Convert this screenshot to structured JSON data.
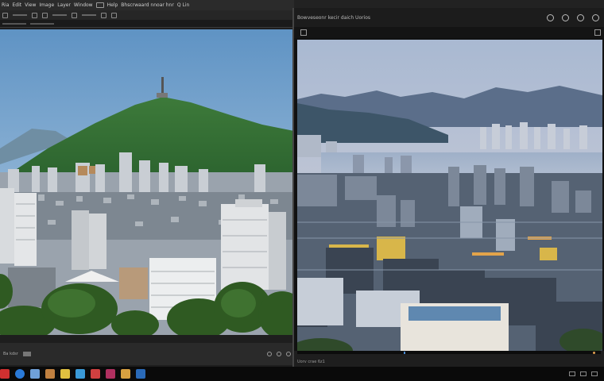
{
  "left_window": {
    "menu_label": "Ria",
    "menu_items": [
      "Edit",
      "View",
      "Image",
      "Layer",
      "Window"
    ],
    "toolbar_labels": [
      "Help",
      "Bhscrwaard nnoar hnr",
      "Q Lin"
    ],
    "status_text": "Ba  kdsr"
  },
  "right_window": {
    "title": "Bowveseonr kecir daich Uorios",
    "status_text": "Uorv crae 6z1"
  },
  "colors": {
    "window_bg": "#1e1e1e",
    "taskbar_bg": "#0a0a0a",
    "accent_orange": "#e0a050"
  },
  "taskbar": {
    "icons": [
      {
        "name": "start-icon",
        "color": "#d03030"
      },
      {
        "name": "browser-icon",
        "color": "#2a7ad8"
      },
      {
        "name": "mail-icon",
        "color": "#6fa0d8"
      },
      {
        "name": "photo-icon",
        "color": "#c08040"
      },
      {
        "name": "notes-icon",
        "color": "#e0c040"
      },
      {
        "name": "store-icon",
        "color": "#3a9ad8"
      },
      {
        "name": "calendar-icon",
        "color": "#d04040"
      },
      {
        "name": "media-icon",
        "color": "#b03060"
      },
      {
        "name": "folder-icon",
        "color": "#d8a040"
      },
      {
        "name": "app-icon",
        "color": "#2a6ab8"
      }
    ]
  }
}
